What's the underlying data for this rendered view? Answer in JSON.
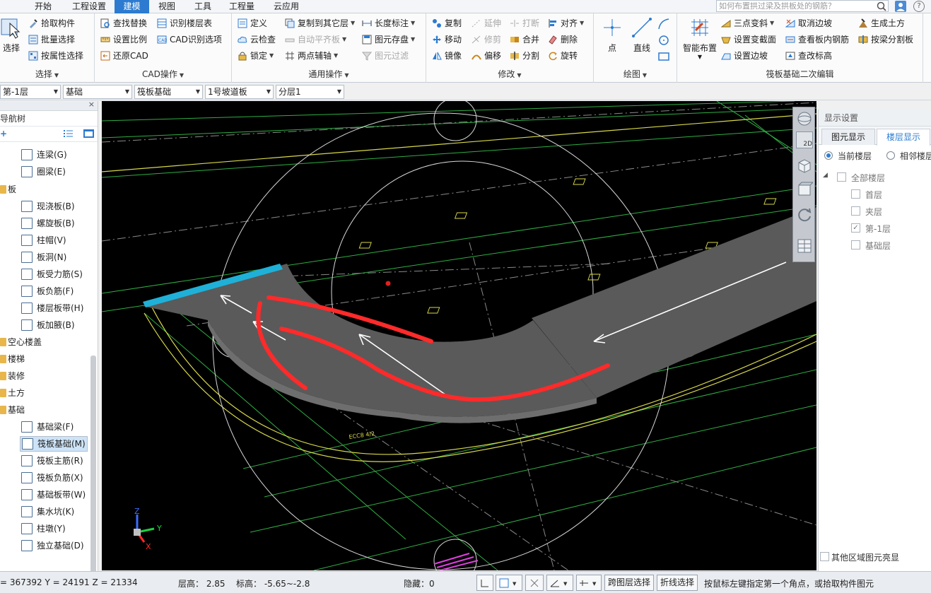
{
  "menu": {
    "tabs": [
      "开始",
      "工程设置",
      "建模",
      "视图",
      "工具",
      "工程量",
      "云应用"
    ],
    "active": "建模",
    "search_placeholder": "如何布置拱过梁及拱板处的钢筋？"
  },
  "ribbon": {
    "select_group": {
      "label": "选择",
      "big": "选择",
      "items": [
        "拾取构件",
        "批量选择",
        "按属性选择"
      ]
    },
    "cad_group": {
      "label": "CAD操作",
      "items": [
        "查找替换",
        "识别楼层表",
        "设置比例",
        "CAD识别选项",
        "还原CAD"
      ]
    },
    "common_group": {
      "label": "通用操作",
      "items": [
        "定义",
        "复制到其它层",
        "长度标注",
        "云检查",
        "自动平齐板",
        "图元存盘",
        "锁定",
        "两点辅轴",
        "图元过滤"
      ]
    },
    "modify_group": {
      "label": "修改",
      "items": [
        "复制",
        "延伸",
        "打断",
        "对齐",
        "移动",
        "修剪",
        "合并",
        "删除",
        "镜像",
        "偏移",
        "分割",
        "旋转"
      ]
    },
    "draw_group": {
      "label": "绘图",
      "items": [
        "点",
        "直线"
      ]
    },
    "raft_group": {
      "label": "筏板基础二次编辑",
      "big": "智能布置",
      "items": [
        "三点变斜",
        "取消边坡",
        "生成土方",
        "设置变截面",
        "查看板内钢筋",
        "按梁分割板",
        "设置边坡",
        "查改标高"
      ]
    }
  },
  "selectors": [
    "第-1层",
    "基础",
    "筏板基础",
    "1号坡道板",
    "分层1"
  ],
  "nav": {
    "title": "导航树",
    "items": [
      {
        "label": "连梁(G)",
        "type": "item"
      },
      {
        "label": "圈梁(E)",
        "type": "item"
      },
      {
        "label": "板",
        "type": "folder"
      },
      {
        "label": "现浇板(B)",
        "type": "item"
      },
      {
        "label": "螺旋板(B)",
        "type": "item"
      },
      {
        "label": "柱帽(V)",
        "type": "item"
      },
      {
        "label": "板洞(N)",
        "type": "item"
      },
      {
        "label": "板受力筋(S)",
        "type": "item"
      },
      {
        "label": "板负筋(F)",
        "type": "item"
      },
      {
        "label": "楼层板带(H)",
        "type": "item"
      },
      {
        "label": "板加腋(B)",
        "type": "item"
      },
      {
        "label": "空心楼盖",
        "type": "folder"
      },
      {
        "label": "楼梯",
        "type": "folder"
      },
      {
        "label": "装修",
        "type": "folder"
      },
      {
        "label": "土方",
        "type": "folder"
      },
      {
        "label": "基础",
        "type": "folder"
      },
      {
        "label": "基础梁(F)",
        "type": "item"
      },
      {
        "label": "筏板基础(M)",
        "type": "item",
        "selected": true
      },
      {
        "label": "筏板主筋(R)",
        "type": "item"
      },
      {
        "label": "筏板负筋(X)",
        "type": "item"
      },
      {
        "label": "基础板带(W)",
        "type": "item"
      },
      {
        "label": "集水坑(K)",
        "type": "item"
      },
      {
        "label": "柱墩(Y)",
        "type": "item"
      },
      {
        "label": "独立基础(D)",
        "type": "item"
      }
    ]
  },
  "viewport": {
    "axis_labels": {
      "z": "Z",
      "y": "Y",
      "x": "X"
    },
    "view_toolbar": [
      "2D",
      "3D",
      "rotate",
      "grid"
    ],
    "view_2d_label": "2D",
    "drawing_label": "ECC8 4/2"
  },
  "right_panel": {
    "title": "显示设置",
    "tabs": [
      "图元显示",
      "楼层显示"
    ],
    "active_tab": "楼层显示",
    "radio_current": "当前楼层",
    "radio_adjacent": "相邻楼层",
    "floors": [
      {
        "label": "全部楼层",
        "checked": false
      },
      {
        "label": "首层",
        "checked": false
      },
      {
        "label": "夹层",
        "checked": false
      },
      {
        "label": "第-1层",
        "checked": true
      },
      {
        "label": "基础层",
        "checked": false
      }
    ],
    "other_area": "其他区域图元亮显"
  },
  "status": {
    "coords": "= 367392 Y = 24191 Z = 21334",
    "floor_height": "层高： 2.85",
    "elevation": "标高： -5.65~-2.8",
    "hidden": "隐藏：0",
    "cross_layer": "跨图层选择",
    "polyline": "折线选择",
    "hint": "按鼠标左键指定第一个角点，或拾取构件图元"
  },
  "colors": {
    "accent": "#2c7bd0",
    "viewport_bg": "#000000",
    "annotation": "#ff2a2a",
    "grid_green": "#3cb64a",
    "cad_yellow": "#d8d84a"
  }
}
